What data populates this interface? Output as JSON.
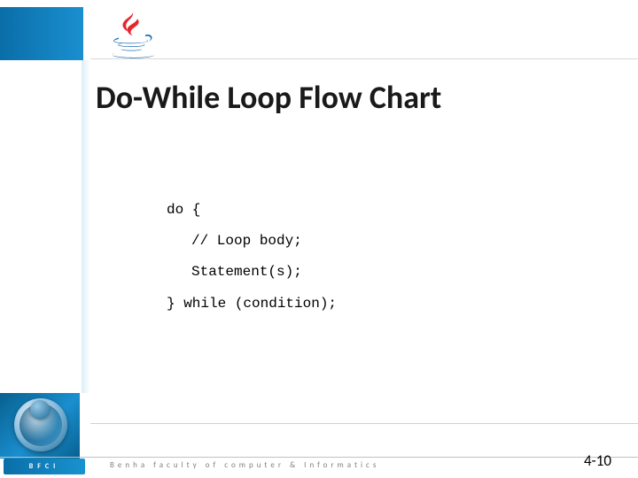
{
  "header": {
    "title": "Do-While Loop Flow Chart"
  },
  "code": {
    "line1": "do {",
    "line2": "// Loop body;",
    "line3": "Statement(s);",
    "line4": "} while (condition);"
  },
  "footer": {
    "org_abbr": "BFCI",
    "org_full": "Benha faculty of computer & Informatics",
    "page": "4-10"
  }
}
